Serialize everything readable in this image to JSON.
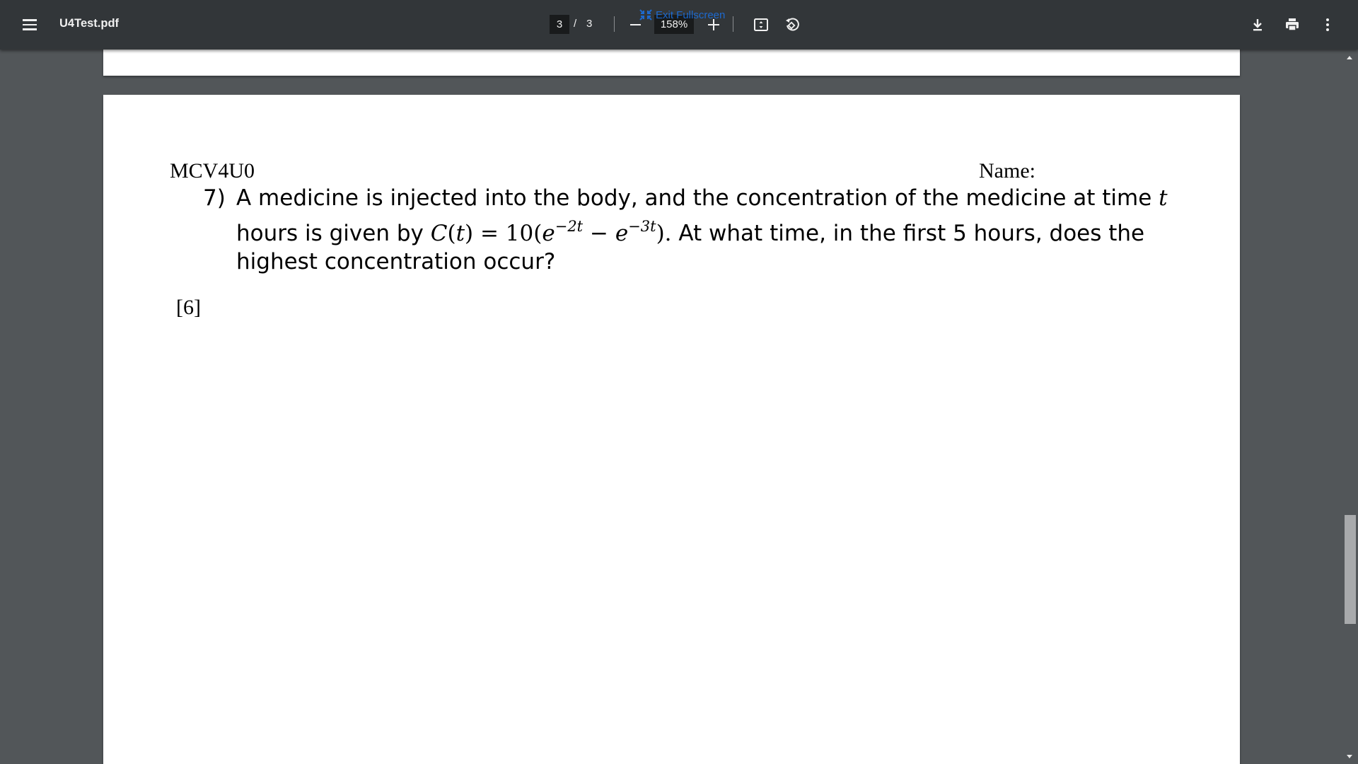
{
  "toolbar": {
    "menu_icon": "hamburger-menu-icon",
    "title": "U4Test.pdf",
    "current_page": "3",
    "page_separator": "/",
    "total_pages": "3",
    "zoom": "158%",
    "exit_fullscreen": "Exit Fullscreen",
    "icons": [
      "zoom-out-icon",
      "zoom-in-icon",
      "fit-page-icon",
      "rotate-icon",
      "download-icon",
      "print-icon",
      "more-options-icon"
    ]
  },
  "document": {
    "course_code": "MCV4U0",
    "name_label": "Name:",
    "question_number": "7)",
    "line1_text": "A medicine is injected into the body, and the concentration of the medicine at time ",
    "line1_var": "t",
    "line2_pre": "hours is given by ",
    "line2_C": "C",
    "line2_paren_open": "(",
    "line2_t": "t",
    "line2_eq": ") = 10(",
    "line2_e1": "e",
    "line2_exp1": "−2t",
    "line2_minus": " − ",
    "line2_e2": "e",
    "line2_exp2": "−3t",
    "line2_close": ").",
    "line2_post": "  At what time, in the first 5 hours, does the",
    "line3_text": "highest concentration occur?",
    "marks": "[6]"
  }
}
